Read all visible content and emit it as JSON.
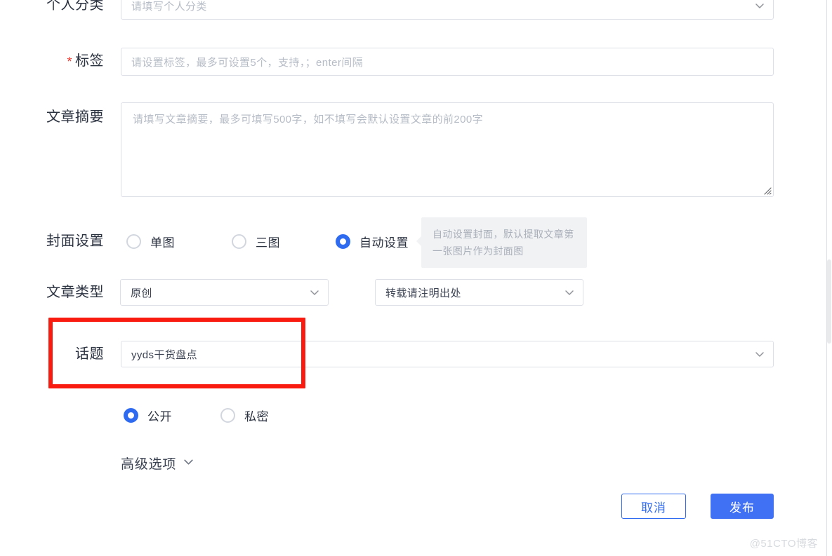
{
  "form": {
    "category": {
      "label": "个人分类",
      "placeholder": "请填写个人分类",
      "icon": "chevron-down-icon"
    },
    "tags": {
      "label": "标签",
      "required_mark": "*",
      "placeholder": "请设置标签，最多可设置5个，支持，；enter间隔"
    },
    "summary": {
      "label": "文章摘要",
      "placeholder": "请填写文章摘要，最多可填写500字，如不填写会默认设置文章的前200字"
    },
    "cover": {
      "label": "封面设置",
      "options": [
        {
          "label": "单图",
          "selected": false
        },
        {
          "label": "三图",
          "selected": false
        },
        {
          "label": "自动设置",
          "selected": true
        }
      ],
      "hint": "自动设置封面，默认提取文章第一张图片作为封面图"
    },
    "article_type": {
      "label": "文章类型",
      "type_value": "原创",
      "reprint_value": "转载请注明出处"
    },
    "topic": {
      "label": "话题",
      "value": "yyds干货盘点",
      "highlighted": true
    },
    "visibility": {
      "options": [
        {
          "label": "公开",
          "selected": true
        },
        {
          "label": "私密",
          "selected": false
        }
      ]
    },
    "advanced": {
      "label": "高级选项",
      "icon": "chevron-down-icon"
    }
  },
  "actions": {
    "cancel_label": "取消",
    "publish_label": "发布"
  },
  "watermark": "@51CTO博客",
  "colors": {
    "primary": "#4070f4",
    "radio_active": "#2f6bf0",
    "annotation": "#f91b10",
    "required": "#e8392f",
    "border": "#dcdfe6",
    "placeholder": "#b6bcc6",
    "hint_bg": "#f1f2f4"
  }
}
